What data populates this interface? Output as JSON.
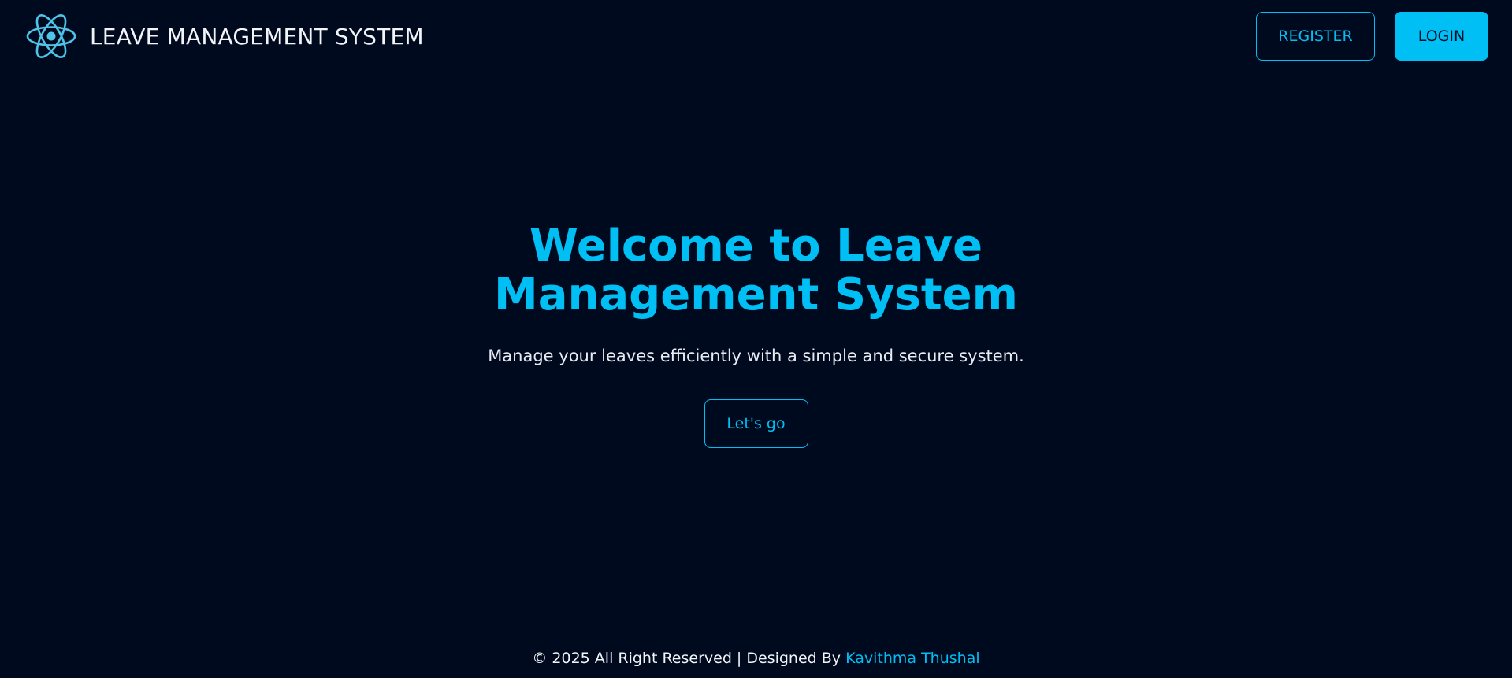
{
  "header": {
    "brand_title": "LEAVE MANAGEMENT SYSTEM",
    "logo_icon": "react-atom-icon",
    "register_label": "REGISTER",
    "login_label": "LOGIN"
  },
  "hero": {
    "title": "Welcome to Leave Management System",
    "subtitle": "Manage your leaves efficiently with a simple and secure system.",
    "cta_label": "Let's go"
  },
  "footer": {
    "copyright_text": "© 2025 All Right Reserved | Designed By",
    "author_name": "Kavithma Thushal"
  },
  "colors": {
    "background": "#000a1f",
    "accent": "#00bff5",
    "text": "#f2f4f8"
  }
}
